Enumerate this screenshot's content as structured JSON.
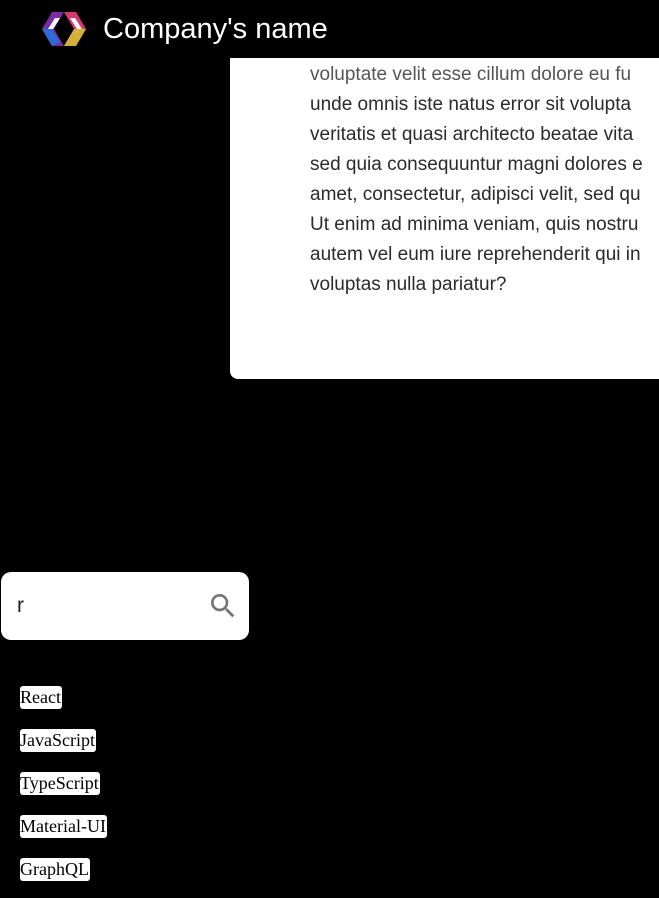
{
  "header": {
    "brand_name": "Company's name",
    "logo_icon": "code-brackets-logo-icon",
    "colors": {
      "left_bracket": "#7b2ca0",
      "left_bracket_accent": "#2b6cd6",
      "right_bracket": "#d63a6e",
      "right_bracket_accent": "#d4b23a"
    }
  },
  "card": {
    "lines": [
      "voluptate velit esse cillum dolore eu fu",
      "unde omnis iste natus error sit volupta",
      "veritatis et quasi architecto beatae vita",
      "sed quia consequuntur magni dolores e",
      "amet, consectetur, adipisci velit, sed qu",
      "Ut enim ad minima veniam, quis nostru",
      "autem vel eum iure reprehenderit qui in",
      "voluptas nulla pariatur?"
    ]
  },
  "search": {
    "value": "r",
    "placeholder": "",
    "icon": "search-icon"
  },
  "tags": [
    "React",
    "JavaScript",
    "TypeScript",
    "Material-UI",
    "GraphQL"
  ]
}
